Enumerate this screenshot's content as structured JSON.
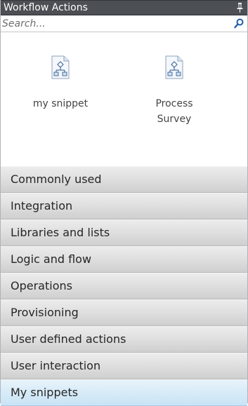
{
  "header": {
    "title": "Workflow Actions"
  },
  "search": {
    "placeholder": "Search..."
  },
  "snippets": [
    {
      "label": "my snippet",
      "icon": "workflow-snippet-icon"
    },
    {
      "label": "Process Survey",
      "icon": "workflow-snippet-icon"
    }
  ],
  "categories": [
    {
      "label": "Commonly used"
    },
    {
      "label": "Integration"
    },
    {
      "label": "Libraries and lists"
    },
    {
      "label": "Logic and flow"
    },
    {
      "label": "Operations"
    },
    {
      "label": "Provisioning"
    },
    {
      "label": "User defined actions"
    },
    {
      "label": "User interaction"
    },
    {
      "label": "My snippets",
      "selected": true
    }
  ],
  "colors": {
    "header_bg": "#4c4f54",
    "category_bg": "#e0e0e0",
    "selected_bg": "#d7ebf8",
    "search_icon": "#1f5fa8"
  }
}
